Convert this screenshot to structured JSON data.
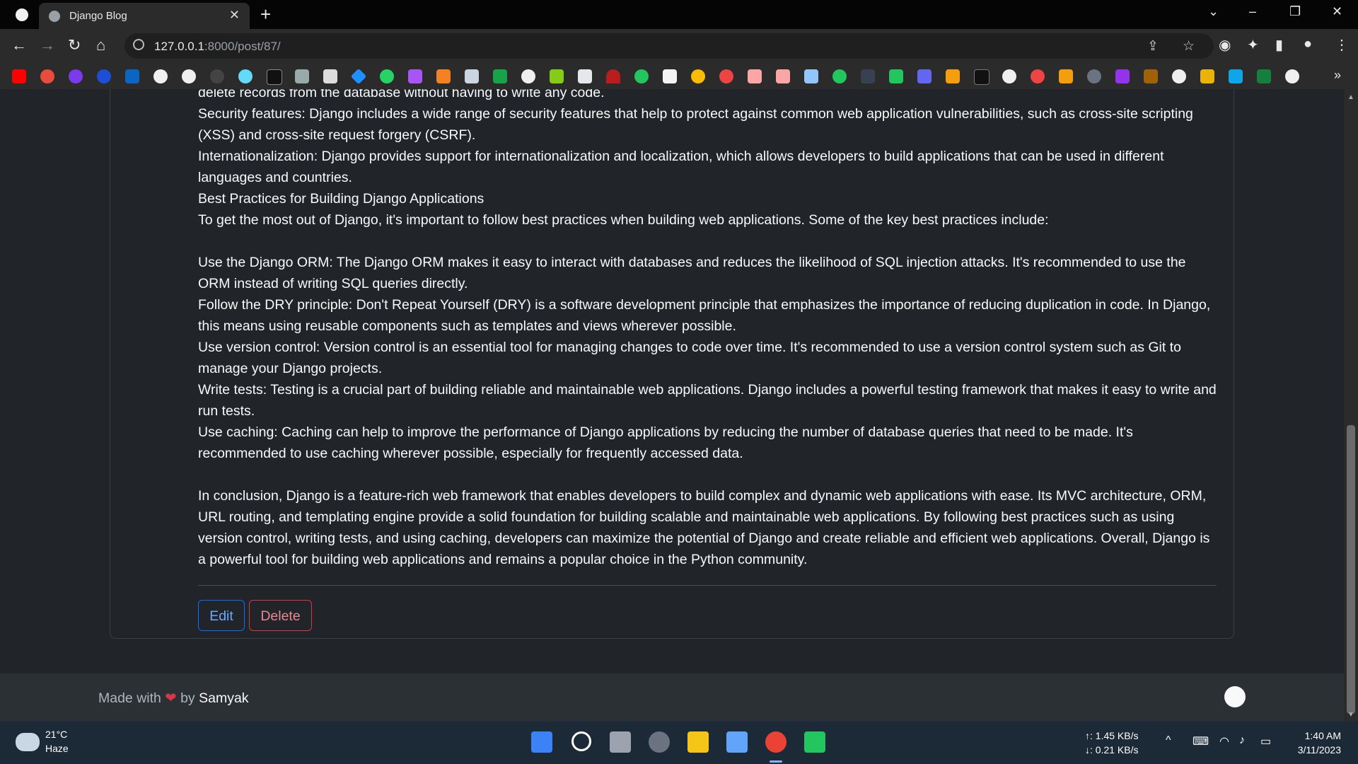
{
  "browser": {
    "tab_title": "Django Blog",
    "tab_close": "✕",
    "new_tab": "+",
    "url_host": "127.0.0.1",
    "url_rest": ":8000/post/87/",
    "window_controls": [
      "⌄",
      "–",
      "❐",
      "✕"
    ]
  },
  "article": {
    "paragraphs": [
      "delete records from the database without having to write any code.",
      "Security features: Django includes a wide range of security features that help to protect against common web application vulnerabilities, such as cross-site scripting (XSS) and cross-site request forgery (CSRF).",
      "Internationalization: Django provides support for internationalization and localization, which allows developers to build applications that can be used in different languages and countries.",
      "Best Practices for Building Django Applications",
      "To get the most out of Django, it's important to follow best practices when building web applications. Some of the key best practices include:",
      "Use the Django ORM: The Django ORM makes it easy to interact with databases and reduces the likelihood of SQL injection attacks. It's recommended to use the ORM instead of writing SQL queries directly.",
      "Follow the DRY principle: Don't Repeat Yourself (DRY) is a software development principle that emphasizes the importance of reducing duplication in code. In Django, this means using reusable components such as templates and views wherever possible.",
      "Use version control: Version control is an essential tool for managing changes to code over time. It's recommended to use a version control system such as Git to manage your Django projects.",
      "Write tests: Testing is a crucial part of building reliable and maintainable web applications. Django includes a powerful testing framework that makes it easy to write and run tests.",
      "Use caching: Caching can help to improve the performance of Django applications by reducing the number of database queries that need to be made. It's recommended to use caching wherever possible, especially for frequently accessed data.",
      "In conclusion, Django is a feature-rich web framework that enables developers to build complex and dynamic web applications with ease. Its MVC architecture, ORM, URL routing, and templating engine provide a solid foundation for building scalable and maintainable web applications. By following best practices such as using version control, writing tests, and using caching, developers can maximize the potential of Django and create reliable and efficient web applications. Overall, Django is a powerful tool for building web applications and remains a popular choice in the Python community."
    ]
  },
  "actions": {
    "edit_label": "Edit",
    "delete_label": "Delete"
  },
  "footer": {
    "made_with": "Made with",
    "heart": "❤",
    "by": "by",
    "author": "Samyak"
  },
  "taskbar": {
    "temp": "21°C",
    "condition": "Haze",
    "net_up": "↑: 1.45 KB/s",
    "net_down": "↓: 0.21 KB/s",
    "time": "1:40 AM",
    "date": "3/11/2023"
  },
  "colors": {
    "page_bg": "#212529",
    "edit_border": "#0d6efd",
    "delete_border": "#dc3545",
    "heart": "#dc3545",
    "taskbar_bg": "#1c2a38"
  },
  "bookmarks_icons": [
    "youtube-icon",
    "sync-icon",
    "upwork-icon",
    "c-icon",
    "linkedin-icon",
    "github-icon",
    "github-icon",
    "github-icon",
    "react-icon",
    "hackerrank-icon",
    "gallery-icon",
    "potion-icon",
    "diamond-icon",
    "whatsapp-icon",
    "hexagon-icon",
    "stackoverflow-icon",
    "shield-icon",
    "green-square-icon",
    "globe-icon",
    "android-icon",
    "printer-icon",
    "speed-icon",
    "circle-icon",
    "wikipedia-icon",
    "chrome-icon",
    "gfg-icon",
    "code-icon",
    "code-icon",
    "grid-icon",
    "s-icon",
    "one-icon",
    "phone-icon",
    "link-icon",
    "dashboard-icon",
    "folder-icon",
    "globe-icon",
    "pdf-icon",
    "stack-icon",
    "w-icon",
    "hash-icon",
    "table-icon",
    "globe-icon",
    "chevron-icon",
    "s-blue-icon",
    "gfg-icon",
    "globe-icon"
  ]
}
